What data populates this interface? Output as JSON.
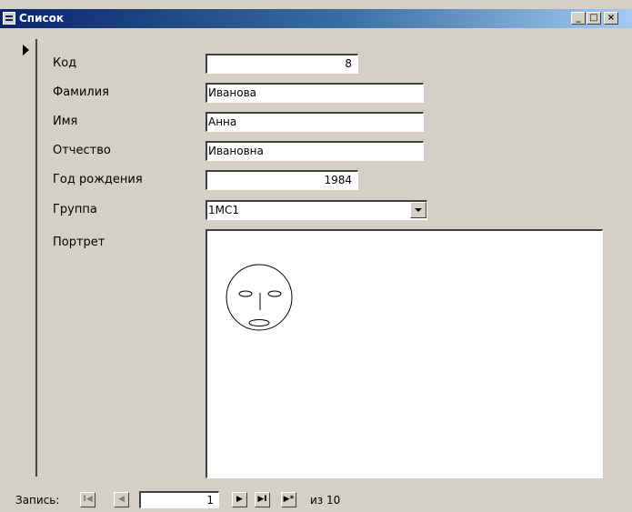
{
  "window": {
    "title": "Список",
    "controls": {
      "minimize": "_",
      "maximize": "□",
      "close": "×"
    }
  },
  "record_selector": {
    "icon": "current-record-arrow-icon"
  },
  "form": {
    "fields": [
      {
        "label": "Код",
        "value": "8"
      },
      {
        "label": "Фамилия",
        "value": "Иванова"
      },
      {
        "label": "Имя",
        "value": "Анна"
      },
      {
        "label": "Отчество",
        "value": "Ивановна"
      },
      {
        "label": "Год рождения",
        "value": "1984"
      },
      {
        "label": "Группа",
        "value": "1МС1"
      },
      {
        "label": "Портрет",
        "value": ""
      }
    ]
  },
  "navigation": {
    "label": "Запись:",
    "current": "1",
    "of_text": "из 10",
    "buttons": {
      "first": "I◀",
      "prev": "◀",
      "next": "▶",
      "last": "▶I",
      "new": "▶*"
    }
  }
}
